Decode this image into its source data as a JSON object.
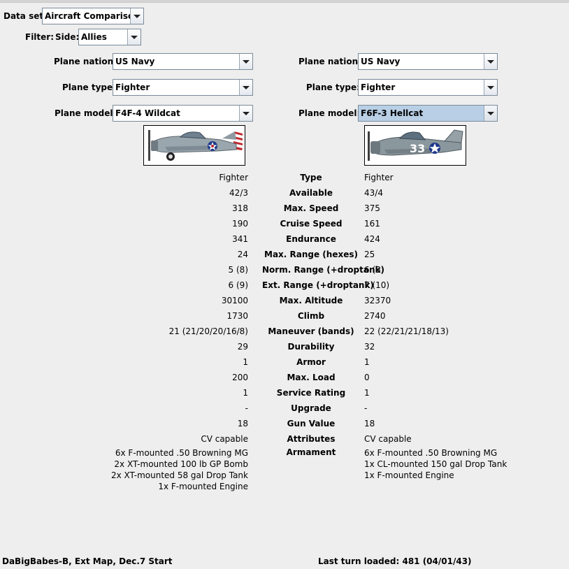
{
  "dataset": {
    "label": "Data set:",
    "value": "Aircraft Comparison"
  },
  "filter": {
    "label": "Filter:",
    "side_label": "Side:",
    "side_value": "Allies"
  },
  "left": {
    "nation_label": "Plane nation:",
    "nation": "US Navy",
    "type_label": "Plane type:",
    "type": "Fighter",
    "model_label": "Plane model:",
    "model": "F4F-4 Wildcat"
  },
  "right": {
    "nation_label": "Plane nation:",
    "nation": "US Navy",
    "type_label": "Plane type:",
    "type": "Fighter",
    "model_label": "Plane model:",
    "model": "F6F-3 Hellcat"
  },
  "right_plane_number": "33",
  "stats": [
    {
      "label": "Type",
      "left": "Fighter",
      "right": "Fighter"
    },
    {
      "label": "Available",
      "left": "42/3",
      "right": "43/4"
    },
    {
      "label": "Max. Speed",
      "left": "318",
      "right": "375"
    },
    {
      "label": "Cruise Speed",
      "left": "190",
      "right": "161"
    },
    {
      "label": "Endurance",
      "left": "341",
      "right": "424"
    },
    {
      "label": "Max. Range (hexes)",
      "left": "24",
      "right": "25"
    },
    {
      "label": "Norm. Range (+droptank)",
      "left": "5 (8)",
      "right": "6 (8)"
    },
    {
      "label": "Ext. Range (+droptank)",
      "left": "6 (9)",
      "right": "7 (10)"
    },
    {
      "label": "Max. Altitude",
      "left": "30100",
      "right": "32370"
    },
    {
      "label": "Climb",
      "left": "1730",
      "right": "2740"
    },
    {
      "label": "Maneuver (bands)",
      "left": "21 (21/20/20/16/8)",
      "right": "22 (22/21/21/18/13)"
    },
    {
      "label": "Durability",
      "left": "29",
      "right": "32"
    },
    {
      "label": "Armor",
      "left": "1",
      "right": "1"
    },
    {
      "label": "Max. Load",
      "left": "200",
      "right": "0"
    },
    {
      "label": "Service Rating",
      "left": "1",
      "right": "1"
    },
    {
      "label": "Upgrade",
      "left": "-",
      "right": "-"
    },
    {
      "label": "Gun Value",
      "left": "18",
      "right": "18"
    },
    {
      "label": "Attributes",
      "left": "CV capable",
      "right": "CV capable"
    }
  ],
  "armament": {
    "label": "Armament",
    "left": [
      "6x F-mounted .50 Browning MG",
      "2x XT-mounted 100 lb GP Bomb",
      "2x XT-mounted 58 gal Drop Tank",
      "1x F-mounted Engine"
    ],
    "right": [
      "6x F-mounted .50 Browning MG",
      "1x CL-mounted 150 gal Drop Tank",
      "1x F-mounted Engine"
    ]
  },
  "status": {
    "scenario": "DaBigBabes-B, Ext Map, Dec.7 Start",
    "last_turn": "Last turn loaded: 481 (04/01/43)"
  }
}
